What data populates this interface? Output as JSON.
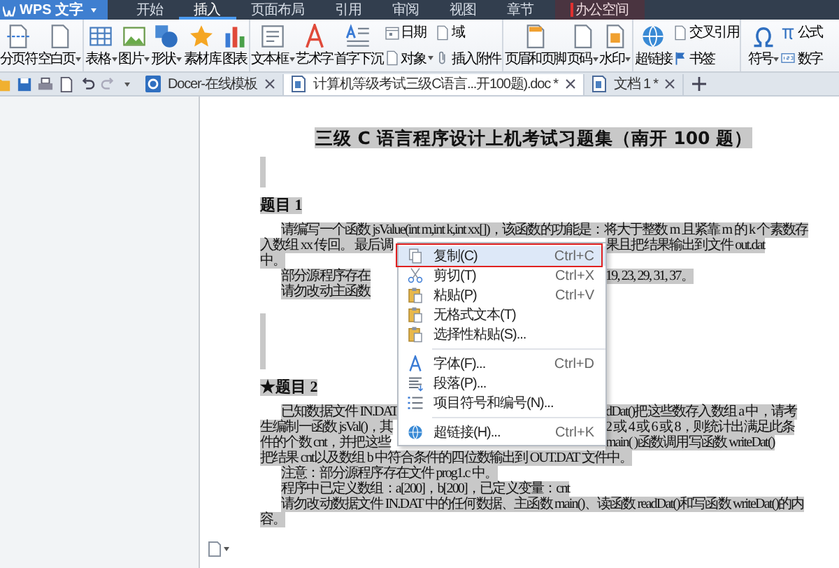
{
  "app_button": "WPS 文字",
  "menu_tabs": [
    {
      "label": "开始",
      "selected": false,
      "kind": "tab"
    },
    {
      "label": "插入",
      "selected": true,
      "kind": "tab"
    },
    {
      "label": "页面布局",
      "selected": false,
      "kind": "tab"
    },
    {
      "label": "引用",
      "selected": false,
      "kind": "tab"
    },
    {
      "label": "审阅",
      "selected": false,
      "kind": "tab"
    },
    {
      "label": "视图",
      "selected": false,
      "kind": "tab"
    },
    {
      "label": "章节",
      "selected": false,
      "kind": "tab"
    },
    {
      "label": "办公空间",
      "selected": false,
      "kind": "space"
    }
  ],
  "ribbon_groups": [
    {
      "columns": [
        {
          "kind": "large",
          "label": "分页符",
          "dropdown": false
        },
        {
          "kind": "large",
          "label": "空白页",
          "dropdown": true
        }
      ]
    },
    {
      "columns": [
        {
          "kind": "large",
          "label": "表格",
          "dropdown": true
        },
        {
          "kind": "large",
          "label": "图片",
          "dropdown": true
        },
        {
          "kind": "large",
          "label": "形状",
          "dropdown": true
        },
        {
          "kind": "large",
          "label": "素材库",
          "dropdown": false
        },
        {
          "kind": "large",
          "label": "图表",
          "dropdown": false
        }
      ]
    },
    {
      "columns": [
        {
          "kind": "large",
          "label": "文本框",
          "dropdown": true
        },
        {
          "kind": "large",
          "label": "艺术字",
          "dropdown": false
        },
        {
          "kind": "large",
          "label": "首字下沉",
          "dropdown": false
        },
        {
          "kind": "stack",
          "items": [
            {
              "label": "日期",
              "dropdown": false
            },
            {
              "label": "对象",
              "dropdown": true
            }
          ]
        },
        {
          "kind": "stack",
          "items": [
            {
              "label": "域",
              "dropdown": false
            },
            {
              "label": "插入附件",
              "dropdown": false
            }
          ]
        }
      ]
    },
    {
      "columns": [
        {
          "kind": "large",
          "label": "页眉和页脚",
          "dropdown": false
        },
        {
          "kind": "large",
          "label": "页码",
          "dropdown": true
        },
        {
          "kind": "large",
          "label": "水印",
          "dropdown": true
        }
      ]
    },
    {
      "columns": [
        {
          "kind": "large",
          "label": "超链接",
          "dropdown": false
        },
        {
          "kind": "stack",
          "items": [
            {
              "label": "交叉引用",
              "dropdown": false
            },
            {
              "label": "书签",
              "dropdown": false
            }
          ]
        }
      ]
    },
    {
      "columns": [
        {
          "kind": "large",
          "label": "符号",
          "dropdown": true
        },
        {
          "kind": "stack",
          "items": [
            {
              "label": "公式",
              "dropdown": false
            },
            {
              "label": "数字",
              "dropdown": false
            }
          ]
        }
      ]
    }
  ],
  "doc_tabs": [
    {
      "label": "Docer-在线模板",
      "selected": false
    },
    {
      "label": "计算机等级考试三级C语言...开100题).doc *",
      "selected": true
    },
    {
      "label": "文档 1 *",
      "selected": false
    }
  ],
  "document": {
    "selected": true,
    "title": "三级 C 语言程序设计上机考试习题集（南开 100 题）",
    "sections": [
      {
        "heading": "题目 1",
        "lines": [
          {
            "left": "请编写一个函数 jsValue(int m,int k,int xx[])，该函数的功能是：将大于整数 m 且紧靠 m 的 k 个素数存",
            "indent": true
          },
          {
            "left": "入数组 xx 传回。 最后调",
            "right": "果且把结果输出到文件 out.dat",
            "indent": false
          },
          {
            "left": "中。",
            "indent": false
          },
          {
            "left": "部分源程序存在",
            "right": "19, 23, 29, 31, 37。",
            "indent": true
          },
          {
            "left": "请勿改动主函数",
            "indent": true
          }
        ]
      },
      {
        "heading": "★题目 2",
        "lines": [
          {
            "left": "已知数据文件 IN.DAT",
            "right": "dDat()把这些数存入数组 a 中，请考",
            "indent": true
          },
          {
            "left": "生编制一函数 jsVal()，其",
            "right": "2 或 4 或 6 或 8，则统计出满足此条",
            "indent": false
          },
          {
            "left": "件的个数 cnt，并把这些",
            "right": "main( )函数调用写函数 writeDat()",
            "indent": false
          },
          {
            "left": "把结果 cnt以及数组 b 中符合条件的四位数输出到 OUT.DAT 文件中。",
            "indent": false
          },
          {
            "left": "注意：部分源程序存在文件 prog1.c 中。",
            "indent": true
          },
          {
            "left": "程序中已定义数组：a[200]，b[200]，已定义变量：cnt",
            "indent": true
          },
          {
            "left": "请勿改动数据文件 IN.DAT 中的任何数据、主函数 main()、读函数 readDat()和写函数 writeDat()的内",
            "indent": true
          },
          {
            "left": "容。",
            "indent": false
          }
        ]
      }
    ]
  },
  "context_menu": {
    "groups": [
      [
        {
          "label": "复制(C)",
          "shortcut": "Ctrl+C",
          "selected": true
        },
        {
          "label": "剪切(T)",
          "shortcut": "Ctrl+X",
          "selected": false
        },
        {
          "label": "粘贴(P)",
          "shortcut": "Ctrl+V",
          "selected": false
        },
        {
          "label": "无格式文本(T)",
          "selected": false
        },
        {
          "label": "选择性粘贴(S)...",
          "selected": false
        }
      ],
      [
        {
          "label": "字体(F)...",
          "shortcut": "Ctrl+D",
          "selected": false
        },
        {
          "label": "段落(P)...",
          "selected": false
        },
        {
          "label": "项目符号和编号(N)...",
          "selected": false
        }
      ],
      [
        {
          "label": "超链接(H)...",
          "shortcut": "Ctrl+K",
          "selected": false
        }
      ]
    ]
  }
}
